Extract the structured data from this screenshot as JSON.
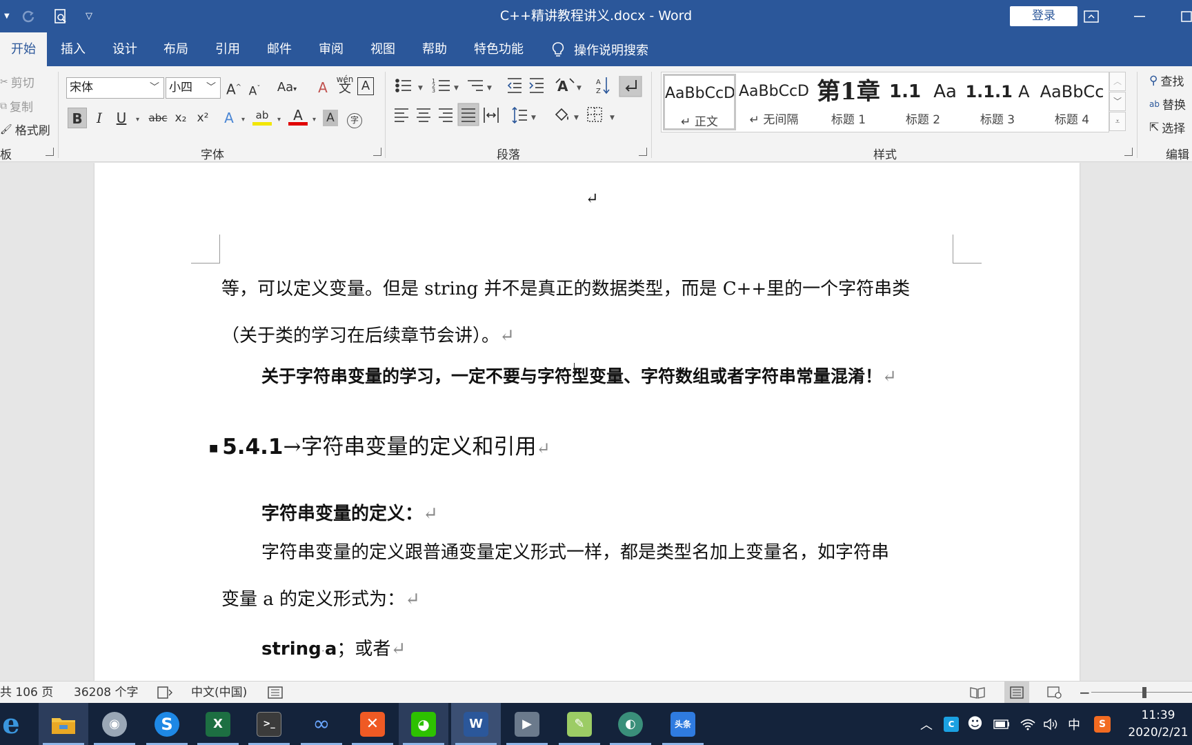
{
  "window": {
    "title": "C++精讲教程讲义.docx  -  Word",
    "login_label": "登录"
  },
  "tabs": [
    "开始",
    "插入",
    "设计",
    "布局",
    "引用",
    "邮件",
    "审阅",
    "视图",
    "帮助",
    "特色功能"
  ],
  "tell_me": "操作说明搜索",
  "ribbon": {
    "clipboard": {
      "cut": "剪切",
      "copy": "复制",
      "format_painter": "格式刷",
      "label": "板"
    },
    "font": {
      "name": "宋体",
      "size": "小四",
      "label": "字体",
      "bold": "B",
      "italic": "I",
      "underline": "U",
      "strike": "abc",
      "subscript": "x₂",
      "superscript": "x²",
      "case": "Aa",
      "grow": "A",
      "shrink": "A",
      "phonetic": "wén",
      "text_effects": "A",
      "highlight": "ab",
      "font_color": "A",
      "char_shading": "A",
      "enclose": "字",
      "clear": "A",
      "border": "A"
    },
    "paragraph": {
      "label": "段落"
    },
    "styles": {
      "label": "样式",
      "items": [
        {
          "sample": "AaBbCcD",
          "name": "↵ 正文"
        },
        {
          "sample": "AaBbCcD",
          "name": "↵ 无间隔"
        },
        {
          "sample": "第1章",
          "name": "标题 1"
        },
        {
          "sample": "1.1",
          "name": "标题 2"
        },
        {
          "sample": "Aa",
          "name": ""
        },
        {
          "sample": "1.1.1",
          "name": "标题 3"
        },
        {
          "sample": "A",
          "name": ""
        },
        {
          "sample": "AaBbCc",
          "name": "标题 4"
        }
      ]
    },
    "editing": {
      "find": "查找",
      "replace": "替换",
      "select": "选择",
      "label": "编辑"
    }
  },
  "document": {
    "header_mark": "↵",
    "line1": "等，可以定义变量。但是 string 并不是真正的数据类型，而是 C++里的一个字符串类",
    "line2": "（关于类的学习在后续章节会讲）。",
    "line3": "关于字符串变量的学习，一定不要与字符型变量、字符数组或者字符串常量混淆！",
    "heading_num": "5.4.1",
    "heading_arrow": "→",
    "heading_text": "字符串变量的定义和引用",
    "subheading": "字符串变量的定义：",
    "line4": "字符串变量的定义跟普通变量定义形式一样，都是类型名加上变量名，如字符串",
    "line5": "变量 a 的定义形式为：",
    "code_keyword": "string",
    "code_dot": "·",
    "code_var": "a",
    "code_tail": "；或者",
    "para_mark": "↵"
  },
  "statusbar": {
    "pages": "共 106 页",
    "words": "36208 个字",
    "language": "中文(中国)"
  },
  "taskbar": {
    "time": "11:39",
    "date": "2020/2/21",
    "ime": "中",
    "apps": [
      "edge",
      "file-explorer",
      "snipping",
      "sogou",
      "excel",
      "editor",
      "link",
      "xmind",
      "wechat",
      "word",
      "video",
      "notepad",
      "browser",
      "toutiao"
    ],
    "toutiao_label": "头条"
  },
  "colors": {
    "word_blue": "#2b579a",
    "ribbon_bg": "#f3f3f3",
    "taskbar_bg": "#14233b"
  }
}
